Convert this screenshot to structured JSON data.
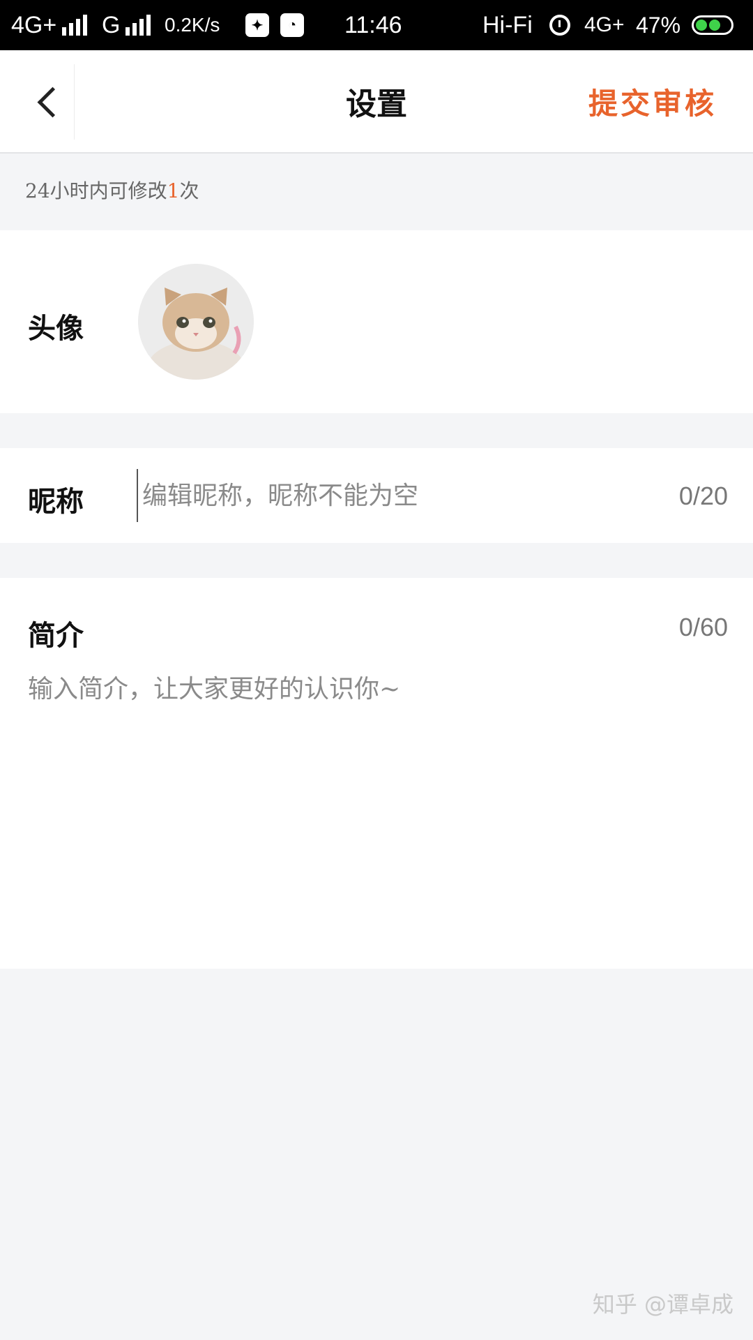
{
  "status_bar": {
    "net1": "4G+",
    "net2": "G",
    "speed": "0.2K/s",
    "time": "11:46",
    "hifi": "Hi-Fi",
    "net3": "4G+",
    "battery": "47%"
  },
  "nav": {
    "title": "设置",
    "submit_label": "提交审核"
  },
  "hint": {
    "prefix": "24小时内可修改",
    "count": "1",
    "suffix": "次"
  },
  "avatar": {
    "label": "头像"
  },
  "nickname": {
    "label": "昵称",
    "value": "",
    "placeholder": "编辑昵称，昵称不能为空",
    "counter": "0/20"
  },
  "bio": {
    "label": "简介",
    "value": "",
    "placeholder": "输入简介，让大家更好的认识你~",
    "counter": "0/60"
  },
  "watermark": "知乎 @谭卓成"
}
